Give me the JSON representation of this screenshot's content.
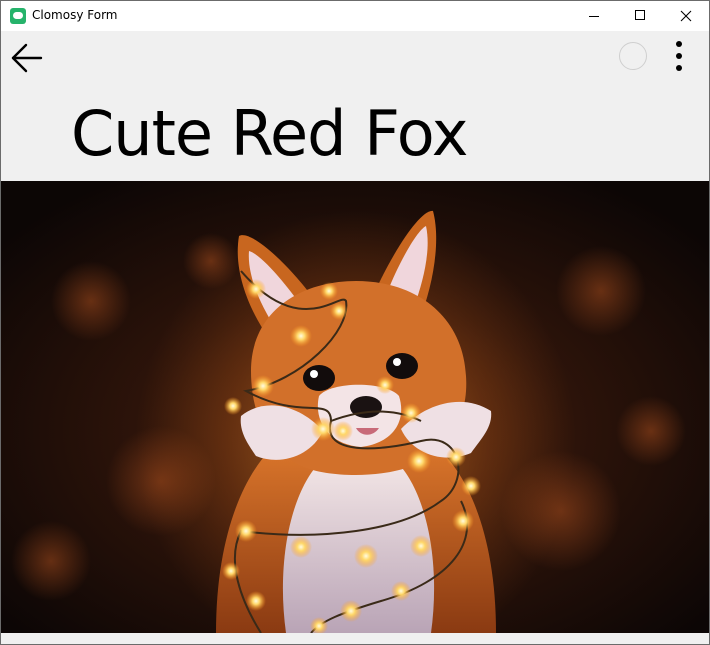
{
  "window": {
    "title": "Clomosy Form",
    "icon": "clomosy-app-icon",
    "controls": [
      "minimize-icon",
      "maximize-icon",
      "close-icon"
    ]
  },
  "appbar": {
    "back_icon": "arrow-left-icon",
    "status_icon": "circle-icon",
    "menu_icon": "more-vertical-icon",
    "title": "Cute Red Fox"
  },
  "image": {
    "description_icon": "fox-illustration"
  },
  "colors": {
    "titlebar_bg": "#ffffff",
    "content_bg": "#f0f0f0",
    "app_icon": "#26b36b",
    "text": "#000000"
  }
}
